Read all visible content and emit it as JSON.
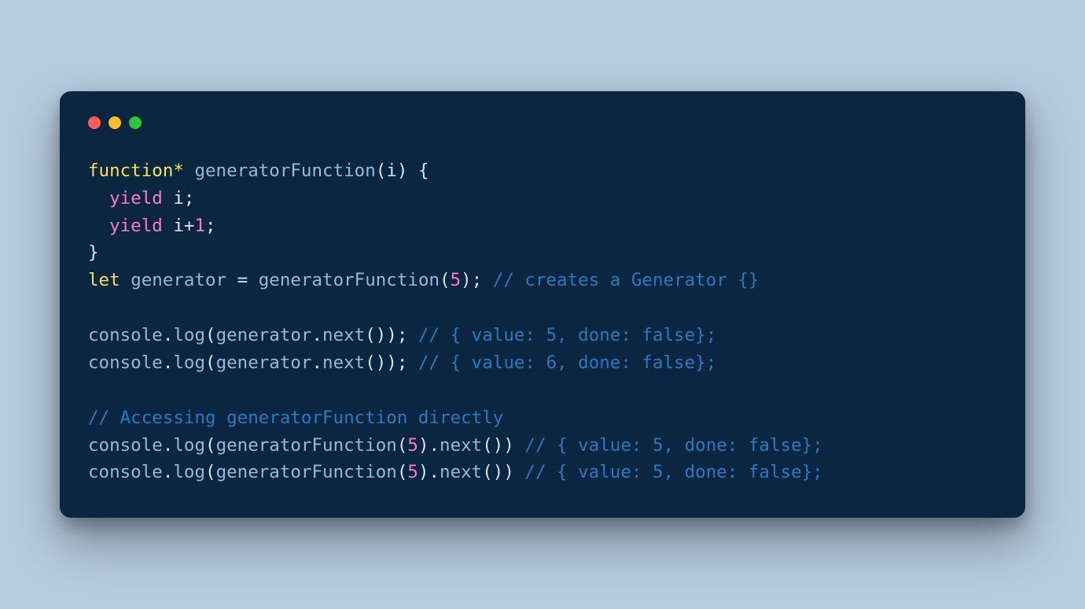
{
  "colors": {
    "page_bg": "#b6cbdf",
    "window_bg": "#0b2640",
    "dot_red": "#ff5f56",
    "dot_yellow": "#ffbd2e",
    "dot_green": "#27c93f",
    "text": "#d9e3ef",
    "keyword": "#f7e05c",
    "yield_number": "#ff79c6",
    "comment": "#2b79c2",
    "identifier": "#99b7d6"
  },
  "tok": {
    "function_star": "function*",
    "gen_fn_name": "generatorFunction",
    "lp": "(",
    "rp": ")",
    "lb": "{",
    "rb": "}",
    "param_i": "i",
    "space": " ",
    "indent": "  ",
    "yield": "yield",
    "semi": ";",
    "plus": "+",
    "one": "1",
    "let": "let",
    "generator": "generator",
    "eq": " = ",
    "five": "5",
    "cmt_creates": "// creates a Generator {}",
    "console": "console",
    "dot": ".",
    "log": "log",
    "next": "next",
    "cmt_val5": "// { value: 5, done: false};",
    "cmt_val6": "// { value: 6, done: false};",
    "cmt_access": "// Accessing generatorFunction directly"
  }
}
